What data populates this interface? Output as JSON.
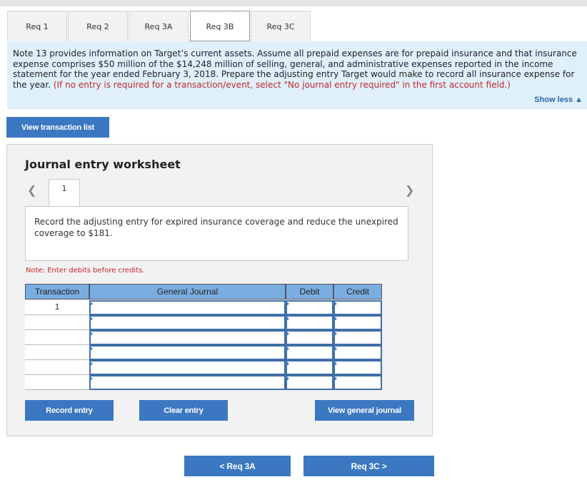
{
  "tabs": [
    {
      "label": "Req 1"
    },
    {
      "label": "Req 2"
    },
    {
      "label": "Req 3A"
    },
    {
      "label": "Req 3B"
    },
    {
      "label": "Req 3C"
    }
  ],
  "instructions": {
    "text": "Note 13 provides information on Target’s current assets. Assume all prepaid expenses are for prepaid insurance and that insurance expense comprises $50 million of the $14,248 million of selling, general, and administrative expenses reported in the income statement for the year ended February 3, 2018. Prepare the adjusting entry Target would make to record all insurance expense for the year.",
    "red_text": "(If no entry is required for a transaction/event, select \"No journal entry required\" in the first account field.)",
    "show_less": "Show less ▲"
  },
  "view_transaction_list": "View transaction list",
  "worksheet": {
    "title": "Journal entry worksheet",
    "page_number": "1",
    "description": "Record the adjusting entry for expired insurance coverage and reduce the unexpired coverage to $181.",
    "note": "Note: Enter debits before credits.",
    "headers": {
      "transaction": "Transaction",
      "general_journal": "General Journal",
      "debit": "Debit",
      "credit": "Credit"
    },
    "rows": [
      {
        "transaction": "1"
      },
      {
        "transaction": ""
      },
      {
        "transaction": ""
      },
      {
        "transaction": ""
      },
      {
        "transaction": ""
      },
      {
        "transaction": ""
      }
    ],
    "buttons": {
      "record": "Record entry",
      "clear": "Clear entry",
      "view_journal": "View general journal"
    }
  },
  "nav": {
    "prev": "<  Req 3A",
    "next": "Req 3C  >"
  },
  "colors": {
    "accent": "#3b78c1",
    "header_blue": "#7aaee0",
    "instruction_bg": "#dff0fb",
    "red": "#c0272d"
  }
}
